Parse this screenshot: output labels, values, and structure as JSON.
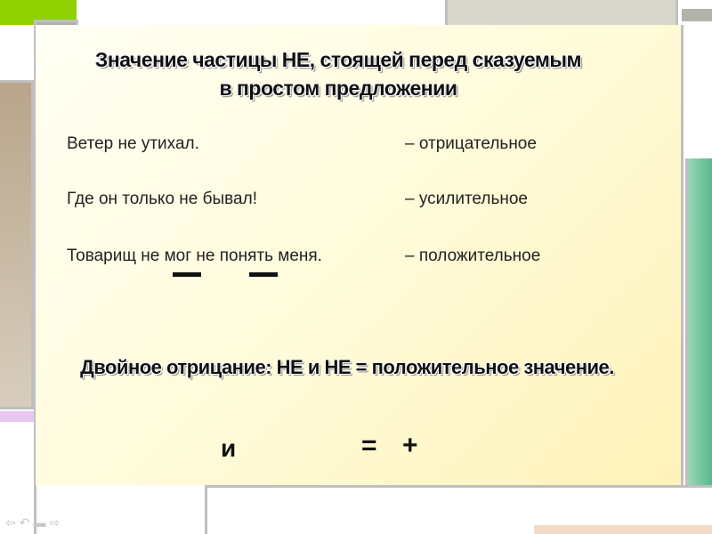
{
  "slide": {
    "title_line1": "Значение частицы НЕ, стоящей перед сказуемым",
    "title_line2": "в простом предложении",
    "rows": [
      {
        "sentence": "Ветер не утихал.",
        "meaning": "– отрицательное"
      },
      {
        "sentence": "Где он только не бывал!",
        "meaning": "– усилительное"
      },
      {
        "sentence": "Товарищ не мог не понять меня.",
        "meaning": "– положительное"
      }
    ],
    "rule": "Двойное отрицание: НЕ и НЕ = положительное значение.",
    "formula": {
      "and": "и",
      "equals": "=",
      "plus": "+"
    }
  },
  "colors": {
    "green": "#8fd100",
    "gray": "#b2b2a8",
    "brown": "#b8a58a",
    "teal": "#52b68a",
    "pink": "#e8c8f0",
    "peach": "#f2dcc8",
    "cream": "#fffde8"
  },
  "nav": {
    "icons": [
      "arrow-left-icon",
      "return-icon",
      "home-icon",
      "arrow-right-icon"
    ]
  }
}
